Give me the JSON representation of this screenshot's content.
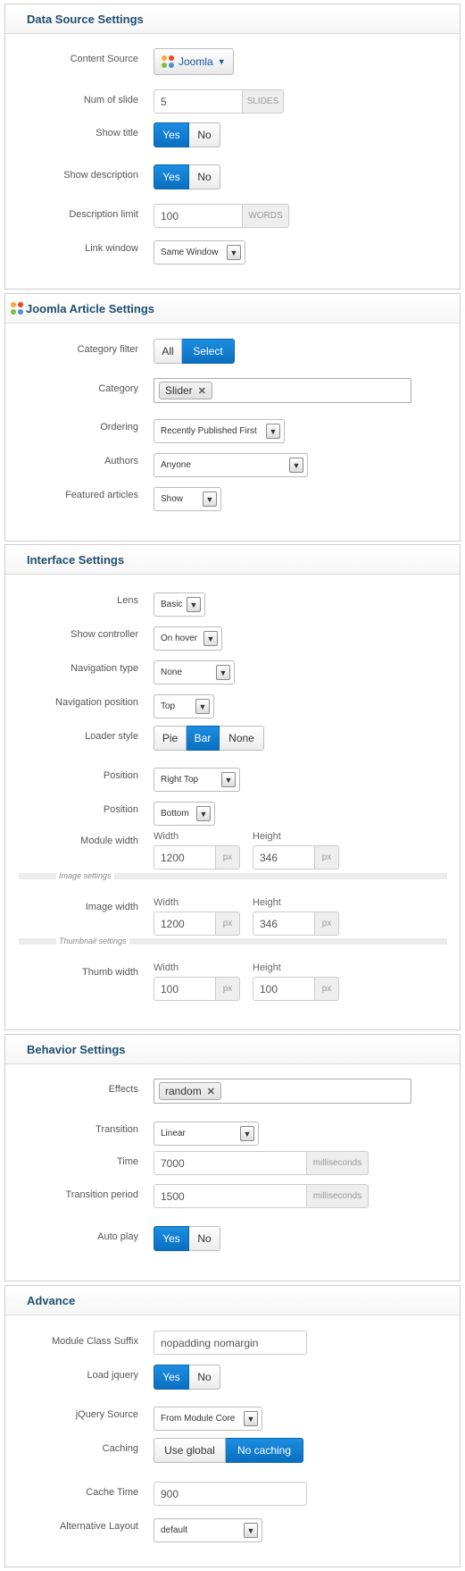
{
  "data_source": {
    "title": "Data Source Settings",
    "content_source": {
      "label": "Content Source",
      "value": "Joomla"
    },
    "num_of_slide": {
      "label": "Num of slide",
      "value": "5",
      "addon": "SLIDES"
    },
    "show_title": {
      "label": "Show title",
      "yes": "Yes",
      "no": "No",
      "selected": "Yes"
    },
    "show_description": {
      "label": "Show description",
      "yes": "Yes",
      "no": "No",
      "selected": "Yes"
    },
    "description_limit": {
      "label": "Description limit",
      "value": "100",
      "addon": "WORDS"
    },
    "link_window": {
      "label": "Link window",
      "value": "Same Window"
    }
  },
  "joomla_article": {
    "title": "Joomla Article Settings",
    "category_filter": {
      "label": "Category filter",
      "all": "All",
      "select": "Select",
      "selected": "Select"
    },
    "category": {
      "label": "Category",
      "tag": "Slider"
    },
    "ordering": {
      "label": "Ordering",
      "value": "Recently Published First"
    },
    "authors": {
      "label": "Authors",
      "value": "Anyone"
    },
    "featured_articles": {
      "label": "Featured articles",
      "value": "Show"
    }
  },
  "interface": {
    "title": "Interface Settings",
    "lens": {
      "label": "Lens",
      "value": "Basic"
    },
    "show_controller": {
      "label": "Show controller",
      "value": "On hover"
    },
    "navigation_type": {
      "label": "Navigation type",
      "value": "None"
    },
    "navigation_position": {
      "label": "Navigation position",
      "value": "Top"
    },
    "loader_style": {
      "label": "Loader style",
      "options": [
        "Pie",
        "Bar",
        "None"
      ],
      "selected": "Bar"
    },
    "position1": {
      "label": "Position",
      "value": "Right Top"
    },
    "position2": {
      "label": "Position",
      "value": "Bottom"
    },
    "module_width": {
      "label": "Module width",
      "width_label": "Width",
      "height_label": "Height",
      "width": "1200",
      "height": "346",
      "unit": "px"
    },
    "image_settings_caption": "Image settings",
    "image_width": {
      "label": "Image width",
      "width_label": "Width",
      "height_label": "Height",
      "width": "1200",
      "height": "346",
      "unit": "px"
    },
    "thumbnail_settings_caption": "Thumbnail settings",
    "thumb_width": {
      "label": "Thumb width",
      "width_label": "Width",
      "height_label": "Height",
      "width": "100",
      "height": "100",
      "unit": "px"
    }
  },
  "behavior": {
    "title": "Behavior Settings",
    "effects": {
      "label": "Effects",
      "tag": "random"
    },
    "transition": {
      "label": "Transition",
      "value": "Linear"
    },
    "time": {
      "label": "Time",
      "value": "7000",
      "addon": "milliseconds"
    },
    "transition_period": {
      "label": "Transition period",
      "value": "1500",
      "addon": "milliseconds"
    },
    "auto_play": {
      "label": "Auto play",
      "yes": "Yes",
      "no": "No",
      "selected": "Yes"
    }
  },
  "advance": {
    "title": "Advance",
    "module_class_suffix": {
      "label": "Module Class Suffix",
      "value": "nopadding nomargin"
    },
    "load_jquery": {
      "label": "Load jquery",
      "yes": "Yes",
      "no": "No",
      "selected": "Yes"
    },
    "jquery_source": {
      "label": "jQuery Source",
      "value": "From Module Core"
    },
    "caching": {
      "label": "Caching",
      "use_global": "Use global",
      "no_caching": "No caching",
      "selected": "No caching"
    },
    "cache_time": {
      "label": "Cache Time",
      "value": "900"
    },
    "alternative_layout": {
      "label": "Alternative Layout",
      "value": "default"
    }
  },
  "colors": {
    "accent": "#0a6fc0",
    "heading": "#1f4e6f"
  }
}
